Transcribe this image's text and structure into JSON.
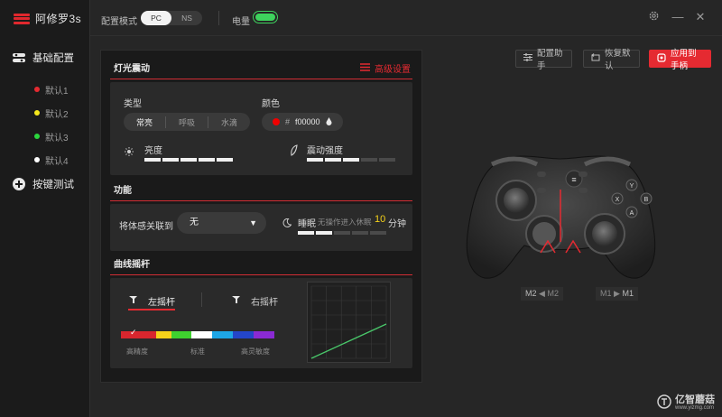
{
  "app": {
    "name": "阿修罗3s"
  },
  "sidebar": {
    "basic_config": "基础配置",
    "presets": [
      {
        "label": "默认1",
        "color": "#e52a31"
      },
      {
        "label": "默认2",
        "color": "#f5e81c"
      },
      {
        "label": "默认3",
        "color": "#2bd63d"
      },
      {
        "label": "默认4",
        "color": "#ffffff"
      }
    ],
    "button_test": "按键测试"
  },
  "topbar": {
    "mode_label": "配置模式",
    "mode_options": [
      "PC",
      "NS"
    ],
    "mode_selected": "PC",
    "battery_label": "电量",
    "battery_level": 1.0
  },
  "actions": {
    "assistant": "配置助手",
    "restore": "恢复默认",
    "apply": "应用到手柄"
  },
  "lighting": {
    "title": "灯光震动",
    "advanced": "高级设置",
    "type_label": "类型",
    "type_options": [
      "常亮",
      "呼吸",
      "水滴"
    ],
    "type_selected": "常亮",
    "color_label": "颜色",
    "color_hash": "#",
    "color_value": "f00000",
    "brightness_label": "亮度",
    "brightness_level": 5,
    "vibration_label": "震动强度",
    "vibration_level": 3,
    "level_max": 5
  },
  "function": {
    "title": "功能",
    "motion_label": "将体感关联到",
    "motion_value": "无",
    "sleep_label": "睡眠",
    "sleep_desc": "无操作进入休眠",
    "sleep_minutes": "10",
    "sleep_unit": "分钟",
    "sleep_level": 2
  },
  "curve": {
    "title": "曲线摇杆",
    "left_stick": "左摇杆",
    "right_stick": "右摇杆",
    "scale_labels": [
      "高精度",
      "标准",
      "高灵敏度"
    ]
  },
  "controller": {
    "m2_label": "M2",
    "m2_sub": "M2",
    "m1_label": "M1",
    "m1_sub": "M1"
  },
  "watermark": {
    "text": "亿智蘑菇",
    "sub": "www.yizmg.com"
  }
}
